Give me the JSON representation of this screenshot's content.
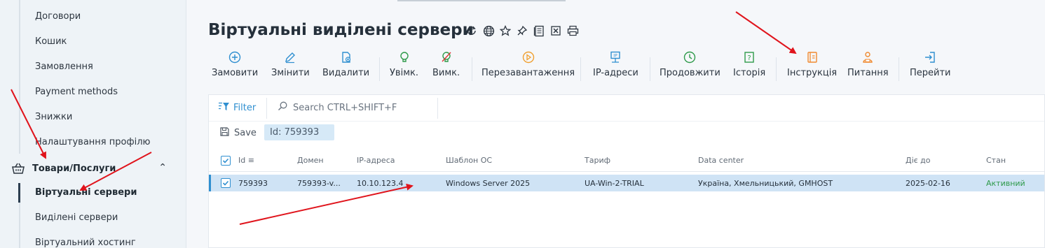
{
  "sidebar": {
    "items": [
      {
        "label": "Договори"
      },
      {
        "label": "Кошик"
      },
      {
        "label": "Замовлення"
      },
      {
        "label": "Payment methods"
      },
      {
        "label": "Знижки"
      },
      {
        "label": "Налаштування профілю"
      }
    ],
    "group": {
      "label": "Товари/Послуги",
      "icon": "basket-icon"
    },
    "subitems": [
      {
        "label": "Віртуальні сервери",
        "active": true
      },
      {
        "label": "Виділені сервери"
      },
      {
        "label": "Віртуальний хостинг"
      }
    ]
  },
  "page": {
    "title": "Віртуальні виділені сервери",
    "title_icons": [
      "refresh-icon",
      "globe-icon",
      "star-icon",
      "pin-icon",
      "document-icon",
      "excel-icon",
      "print-icon"
    ]
  },
  "toolbar": {
    "buttons": [
      {
        "label": "Замовити",
        "icon": "plus-circle-icon",
        "color": "#2f8fd0"
      },
      {
        "label": "Змінити",
        "icon": "pencil-icon",
        "color": "#2f8fd0"
      },
      {
        "label": "Видалити",
        "icon": "delete-file-icon",
        "color": "#2f8fd0"
      },
      {
        "label": "Увімк.",
        "icon": "bulb-on-icon",
        "color": "#2e9a4a"
      },
      {
        "label": "Вимк.",
        "icon": "bulb-off-icon",
        "color": "#2e9a4a"
      },
      {
        "label": "Перезавантаження",
        "icon": "restart-icon",
        "color": "#f0a030"
      },
      {
        "label": "IP-адреси",
        "icon": "ip-icon",
        "color": "#2f8fd0"
      },
      {
        "label": "Продовжити",
        "icon": "clock-icon",
        "color": "#2e9a4a"
      },
      {
        "label": "Історія",
        "icon": "history-icon",
        "color": "#2e9a4a"
      },
      {
        "label": "Інструкція",
        "icon": "instruction-icon",
        "color": "#f08a30"
      },
      {
        "label": "Питання",
        "icon": "question-user-icon",
        "color": "#f08a30"
      },
      {
        "label": "Перейти",
        "icon": "login-icon",
        "color": "#2f8fd0"
      }
    ]
  },
  "filterbar": {
    "filter_label": "Filter",
    "search_placeholder": "Search CTRL+SHIFT+F"
  },
  "savebar": {
    "save_label": "Save",
    "chip_label": "Id: 759393"
  },
  "table": {
    "columns": [
      "Id",
      "Домен",
      "IP-адреса",
      "Шаблон ОС",
      "Тариф",
      "Data center",
      "Діє до",
      "Стан"
    ],
    "rows": [
      [
        "759393",
        "759393-v...",
        "10.10.123.4",
        "Windows Server 2025",
        "UA-Win-2-TRIAL",
        "Україна, Хмельницький, GMHOST",
        "2025-02-16",
        "Активний"
      ]
    ]
  },
  "colors": {
    "accent": "#2f8fd0",
    "status_active": "#2e9a4a",
    "arrow": "#e0141c",
    "selected_row": "#cfe3f5"
  }
}
